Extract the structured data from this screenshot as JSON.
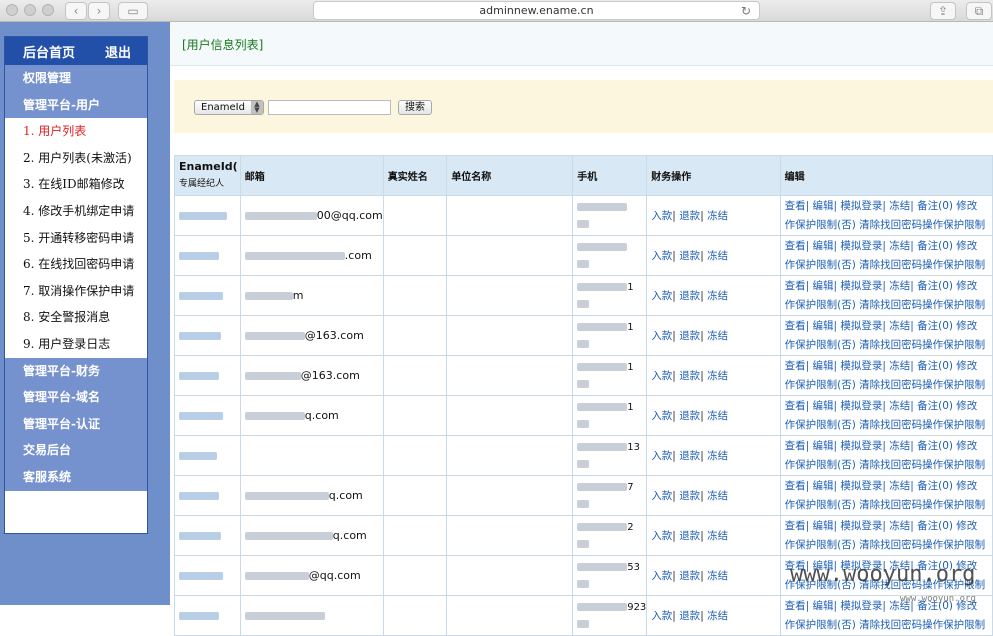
{
  "browser": {
    "url": "adminnew.ename.cn",
    "back_icon": "‹",
    "forward_icon": "›",
    "sidebar_icon": "▭",
    "reload_icon": "↻",
    "share_icon": "⇪",
    "tabs_icon": "⧉"
  },
  "sidebar": {
    "home": "后台首页",
    "logout": "退出",
    "sections": [
      {
        "label": "权限管理"
      },
      {
        "label": "管理平台-用户"
      }
    ],
    "items": [
      {
        "label": "1. 用户列表",
        "active": true
      },
      {
        "label": "2. 用户列表(未激活)"
      },
      {
        "label": "3. 在线ID邮箱修改"
      },
      {
        "label": "4. 修改手机绑定申请"
      },
      {
        "label": "5. 开通转移密码申请"
      },
      {
        "label": "6. 在线找回密码申请"
      },
      {
        "label": "7. 取消操作保护申请"
      },
      {
        "label": "8. 安全警报消息"
      },
      {
        "label": "9. 用户登录日志"
      }
    ],
    "sections_after": [
      {
        "label": "管理平台-财务"
      },
      {
        "label": "管理平台-域名"
      },
      {
        "label": "管理平台-认证"
      },
      {
        "label": "交易后台"
      },
      {
        "label": "客服系统"
      }
    ]
  },
  "main": {
    "breadcrumb": "[用户信息列表]",
    "search": {
      "select_value": "EnameId",
      "button": "搜索"
    },
    "table": {
      "headers": {
        "enameid": "EnameId(",
        "agent": "专属经纪人",
        "email": "邮箱",
        "realname": "真实姓名",
        "company": "单位名称",
        "phone": "手机",
        "finance": "财务操作",
        "edit": "编辑"
      },
      "finance_actions": {
        "deposit": "入款",
        "refund": "退款",
        "freeze": "冻结"
      },
      "edit_line1": "查看| 编辑| 模拟登录| 冻结| 备注(0) 修改",
      "edit_line2": "作保护限制(否) 清除找回密码操作保护限制",
      "rows": [
        {
          "email": "00@qq.com",
          "phone_tail": ""
        },
        {
          "email": ".com",
          "phone_tail": ""
        },
        {
          "email": "m",
          "phone_tail": "1"
        },
        {
          "email": "@163.com",
          "phone_tail": "1"
        },
        {
          "email": "@163.com",
          "phone_tail": "1"
        },
        {
          "email": "q.com",
          "phone_tail": "1"
        },
        {
          "email": "",
          "phone_tail": "13"
        },
        {
          "email": "q.com",
          "phone_tail": "7"
        },
        {
          "email": "q.com",
          "phone_tail": "2"
        },
        {
          "email": "@qq.com",
          "phone_tail": "53"
        },
        {
          "email": "",
          "phone_tail": "923"
        }
      ]
    }
  },
  "watermark": {
    "text": "www.wooyun.org",
    "small": "www.wooyun.org"
  }
}
